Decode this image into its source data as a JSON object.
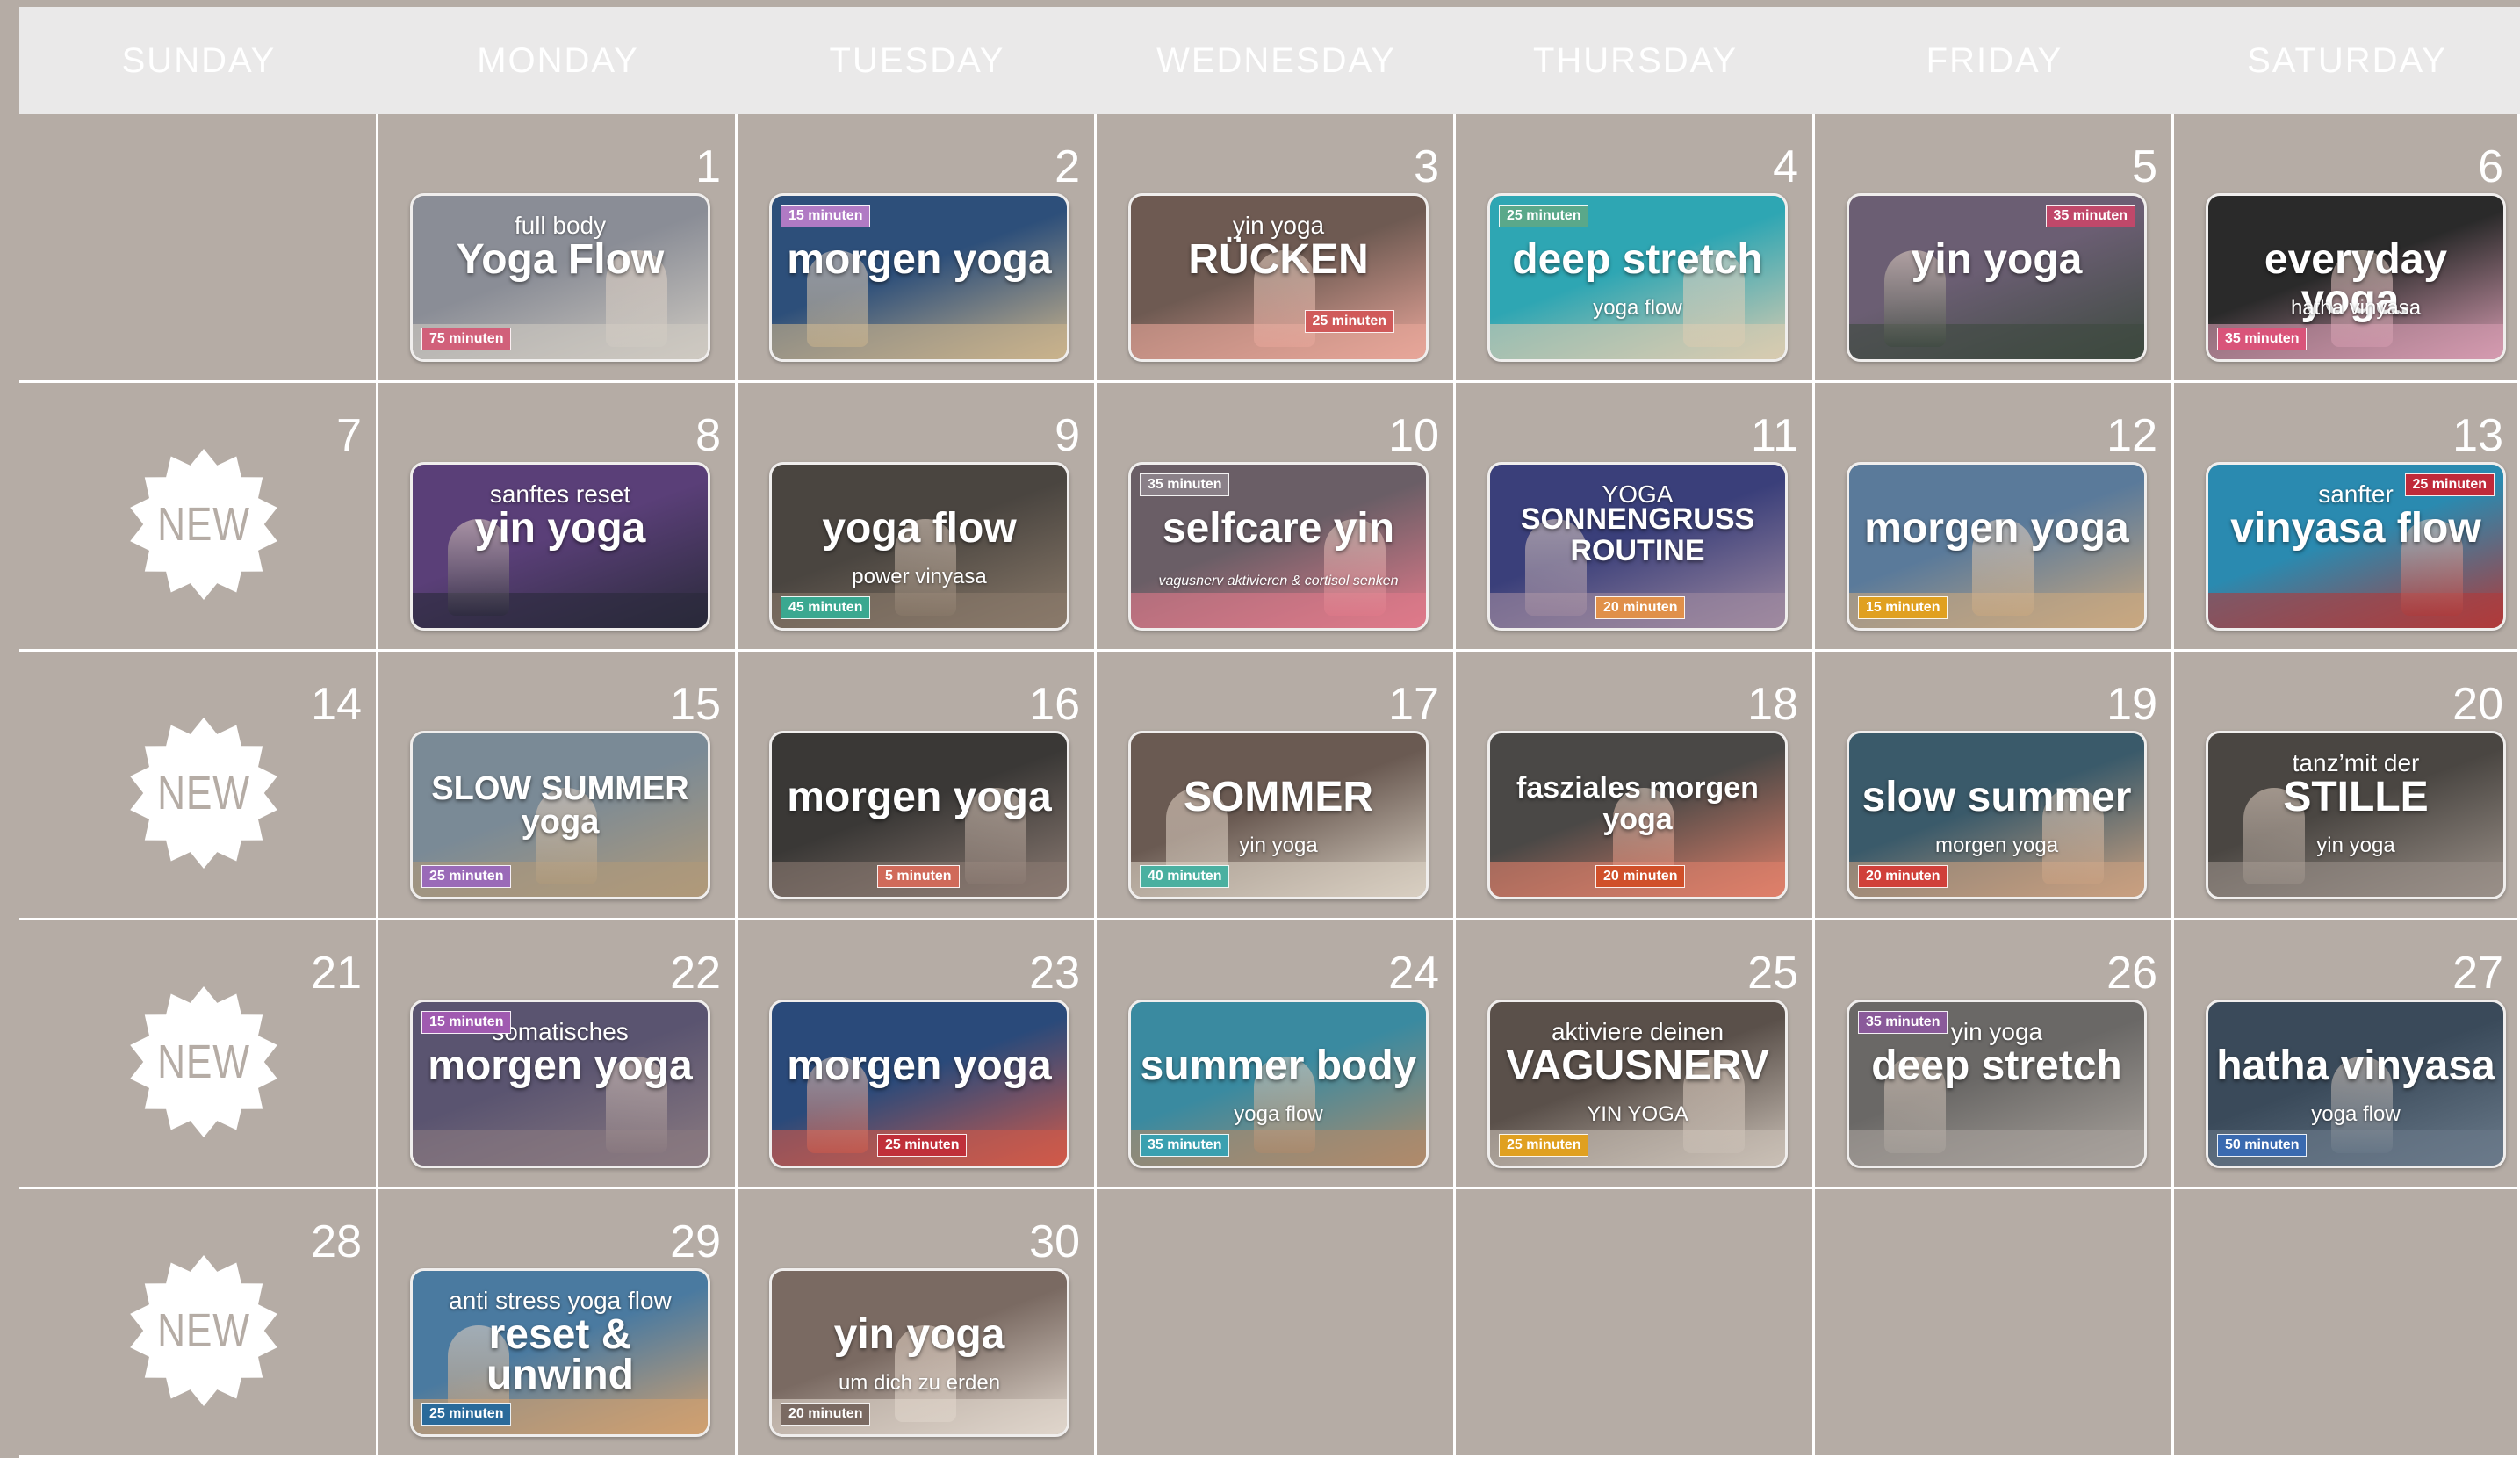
{
  "weekdays": [
    "SUNDAY",
    "MONDAY",
    "TUESDAY",
    "WEDNESDAY",
    "THURSDAY",
    "FRIDAY",
    "SATURDAY"
  ],
  "new_label": "NEW",
  "colors": {
    "background": "#b5aca5",
    "header": "#eae9e9",
    "text": "#ffffff"
  },
  "days": [
    {
      "num": "1",
      "sub": "full body",
      "title": "Yoga Flow",
      "sub2": "",
      "duration": "75 minuten",
      "dur_color": "#d1607a",
      "dur_pos": "bl",
      "bg": "#8a8d96",
      "bg2": "#cfcac2"
    },
    {
      "num": "2",
      "sub": "",
      "title": "morgen yoga",
      "sub2": "",
      "duration": "15 minuten",
      "dur_color": "#b07ac4",
      "dur_pos": "tl",
      "bg": "#2d4f7a",
      "bg2": "#c9b38c"
    },
    {
      "num": "3",
      "sub": "yin yoga",
      "title": "RÜCKEN",
      "sub2": "",
      "duration": "25 minuten",
      "dur_color": "#d05a5a",
      "dur_pos": "br",
      "bg": "#6e5a52",
      "bg2": "#e8a69a"
    },
    {
      "num": "4",
      "sub": "",
      "title": "deep stretch",
      "sub2": "yoga flow",
      "duration": "25 minuten",
      "dur_color": "#5aa88a",
      "dur_pos": "tl",
      "bg": "#2ea6b3",
      "bg2": "#d9cbb0"
    },
    {
      "num": "5",
      "sub": "",
      "title": "yin yoga",
      "sub2": "",
      "duration": "35 minuten",
      "dur_color": "#c0486a",
      "dur_pos": "tr",
      "bg": "#6b5e73",
      "bg2": "#3d4a3f"
    },
    {
      "num": "6",
      "sub": "",
      "title": "everyday yoga.",
      "sub2": "hatha vinyasa",
      "duration": "35 minuten",
      "dur_color": "#d9547a",
      "dur_pos": "bl",
      "bg": "#2a2a2a",
      "bg2": "#d59bb0"
    },
    {
      "num": "7",
      "new": true
    },
    {
      "num": "8",
      "sub": "sanftes reset",
      "title": "yin yoga",
      "sub2": "",
      "duration": "",
      "dur_color": "",
      "dur_pos": "",
      "bg": "#5a3f78",
      "bg2": "#2a2a3a"
    },
    {
      "num": "9",
      "sub": "",
      "title": "yoga flow",
      "sub2": "power vinyasa",
      "duration": "45 minuten",
      "dur_color": "#3aa890",
      "dur_pos": "bl",
      "bg": "#4a4540",
      "bg2": "#8a7a6a"
    },
    {
      "num": "10",
      "sub": "",
      "title": "selfcare yin",
      "sub2": "vagusnerv aktivieren & cortisol senken",
      "duration": "35 minuten",
      "dur_color": "#8a8088",
      "dur_pos": "tl",
      "bg": "#6a5e66",
      "bg2": "#e07a8a"
    },
    {
      "num": "11",
      "sub": "YOGA",
      "title": "SONNENGRUSS ROUTINE",
      "sub2": "",
      "duration": "20 minuten",
      "dur_color": "#e0904a",
      "dur_pos": "bc",
      "bg": "#3a3f7a",
      "bg2": "#a08aa0"
    },
    {
      "num": "12",
      "sub": "",
      "title": "morgen yoga",
      "sub2": "",
      "duration": "15 minuten",
      "dur_color": "#e0a020",
      "dur_pos": "bl",
      "bg": "#5a7a9a",
      "bg2": "#c9a880"
    },
    {
      "num": "13",
      "sub": "sanfter",
      "title": "vinyasa flow",
      "sub2": "",
      "duration": "25 minuten",
      "dur_color": "#c02a3a",
      "dur_pos": "tr",
      "bg": "#2a8ab0",
      "bg2": "#b03a3a"
    },
    {
      "num": "14",
      "new": true
    },
    {
      "num": "15",
      "sub": "",
      "title": "SLOW SUMMER yoga",
      "sub2": "",
      "duration": "25 minuten",
      "dur_color": "#9a6ab8",
      "dur_pos": "bl",
      "bg": "#7a8a96",
      "bg2": "#b09a7a"
    },
    {
      "num": "16",
      "sub": "",
      "title": "morgen yoga",
      "sub2": "",
      "duration": "5 minuten",
      "dur_color": "#d06a5a",
      "dur_pos": "bc",
      "bg": "#3a3836",
      "bg2": "#8a7a72"
    },
    {
      "num": "17",
      "sub": "",
      "title": "SOMMER",
      "sub2": "yin yoga",
      "duration": "40 minuten",
      "dur_color": "#4ab0a0",
      "dur_pos": "bl",
      "bg": "#6a5a52",
      "bg2": "#d8cfc2"
    },
    {
      "num": "18",
      "sub": "",
      "title": "fasziales morgen yoga",
      "sub2": "",
      "duration": "20 minuten",
      "dur_color": "#d0502a",
      "dur_pos": "bc",
      "bg": "#4a4846",
      "bg2": "#e0806a"
    },
    {
      "num": "19",
      "sub": "",
      "title": "slow summer",
      "sub2": "morgen yoga",
      "duration": "20 minuten",
      "dur_color": "#d0403a",
      "dur_pos": "bl",
      "bg": "#3a5a6a",
      "bg2": "#c9a080"
    },
    {
      "num": "20",
      "sub": "tanz’mit der",
      "title": "STILLE",
      "sub2": "yin yoga",
      "duration": "",
      "dur_color": "",
      "dur_pos": "",
      "bg": "#4a4642",
      "bg2": "#9a9088"
    },
    {
      "num": "21",
      "new": true
    },
    {
      "num": "22",
      "sub": "somatisches",
      "title": "morgen yoga",
      "sub2": "",
      "duration": "15 minuten",
      "dur_color": "#a05ab0",
      "dur_pos": "tl",
      "bg": "#5a5470",
      "bg2": "#8a7a80"
    },
    {
      "num": "23",
      "sub": "",
      "title": "morgen yoga",
      "sub2": "",
      "duration": "25 minuten",
      "dur_color": "#c0303a",
      "dur_pos": "bc",
      "bg": "#2a4a7a",
      "bg2": "#d05a4a"
    },
    {
      "num": "24",
      "sub": "",
      "title": "summer body",
      "sub2": "yoga flow",
      "duration": "35 minuten",
      "dur_color": "#3aa0b0",
      "dur_pos": "bl",
      "bg": "#3a8aa0",
      "bg2": "#b08a6a"
    },
    {
      "num": "25",
      "sub": "aktiviere deinen",
      "title": "VAGUSNERV",
      "sub2": "YIN YOGA",
      "duration": "25 minuten",
      "dur_color": "#e0a020",
      "dur_pos": "bl",
      "bg": "#5a504a",
      "bg2": "#c9bfb5"
    },
    {
      "num": "26",
      "sub": "yin yoga",
      "title": "deep stretch",
      "sub2": "",
      "duration": "35 minuten",
      "dur_color": "#8a5a9a",
      "dur_pos": "tl",
      "bg": "#6a6866",
      "bg2": "#a8a29c"
    },
    {
      "num": "27",
      "sub": "",
      "title": "hatha vinyasa",
      "sub2": "yoga flow",
      "duration": "50 minuten",
      "dur_color": "#3a6ab0",
      "dur_pos": "bl",
      "bg": "#3a4a5a",
      "bg2": "#6a7a8a"
    },
    {
      "num": "28",
      "new": true
    },
    {
      "num": "29",
      "sub": "anti stress yoga flow",
      "title": "reset & unwind",
      "sub2": "",
      "duration": "25 minuten",
      "dur_color": "#2a6a9a",
      "dur_pos": "bl",
      "bg": "#4a7aa0",
      "bg2": "#d0a070"
    },
    {
      "num": "30",
      "sub": "",
      "title": "yin yoga",
      "sub2": "um dich zu erden",
      "duration": "20 minuten",
      "dur_color": "#7a6a62",
      "dur_pos": "bl",
      "bg": "#7a6a62",
      "bg2": "#e0d6cc"
    }
  ]
}
